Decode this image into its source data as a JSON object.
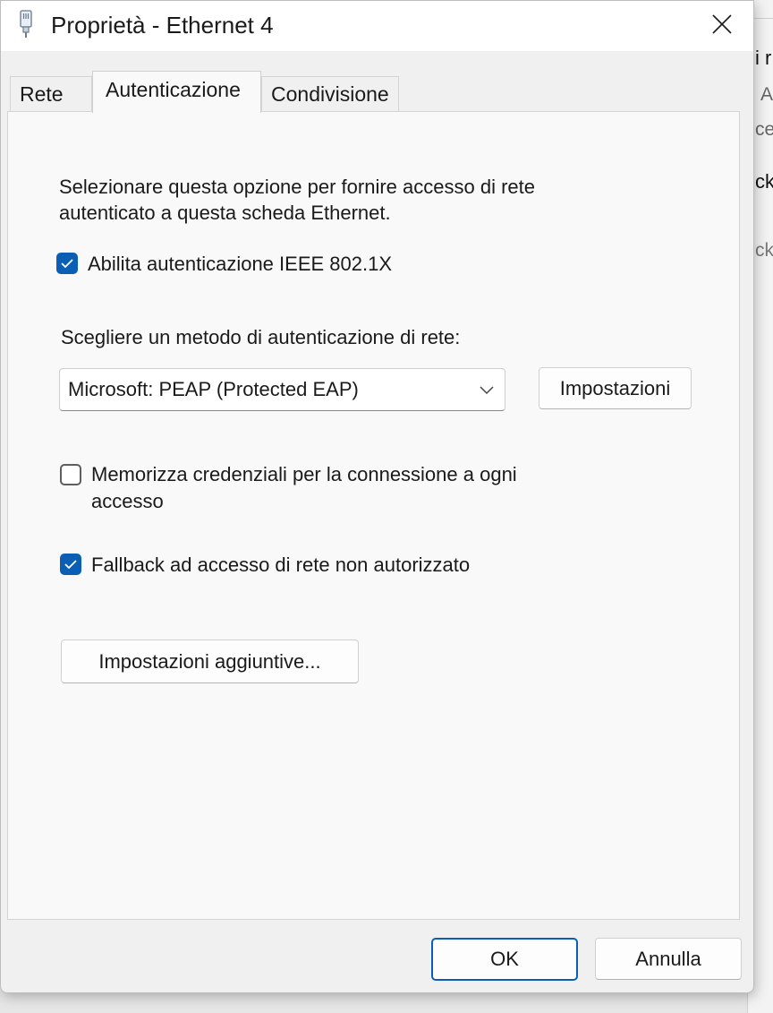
{
  "window": {
    "title": "Proprietà - Ethernet 4",
    "icon": "ethernet-connector-icon",
    "close_icon": "close-icon"
  },
  "tabs": [
    {
      "label": "Rete",
      "active": false
    },
    {
      "label": "Autenticazione",
      "active": true
    },
    {
      "label": "Condivisione",
      "active": false
    }
  ],
  "auth": {
    "description": "Selezionare questa opzione per fornire accesso di rete autenticato a questa scheda Ethernet.",
    "enable_8021x": {
      "label": "Abilita autenticazione IEEE 802.1X",
      "checked": true
    },
    "method_label": "Scegliere un metodo di autenticazione di rete:",
    "method_value": "Microsoft: PEAP (Protected EAP)",
    "settings_button": "Impostazioni",
    "remember_credentials": {
      "label_line1": "Memorizza credenziali per la connessione a ogni",
      "label_line2": "accesso",
      "checked": false
    },
    "fallback": {
      "label": "Fallback ad accesso di rete non autorizzato",
      "checked": true
    },
    "additional_settings_button": "Impostazioni aggiuntive..."
  },
  "footer": {
    "ok_label": "OK",
    "cancel_label": "Annulla"
  },
  "background_window": {
    "fragments": [
      "i r",
      "A",
      "ce",
      "ck",
      "ck"
    ]
  },
  "colors": {
    "accent": "#0a5fb4",
    "dialog_bg": "#f0f0f0",
    "panel_bg": "#f9f9f9"
  }
}
